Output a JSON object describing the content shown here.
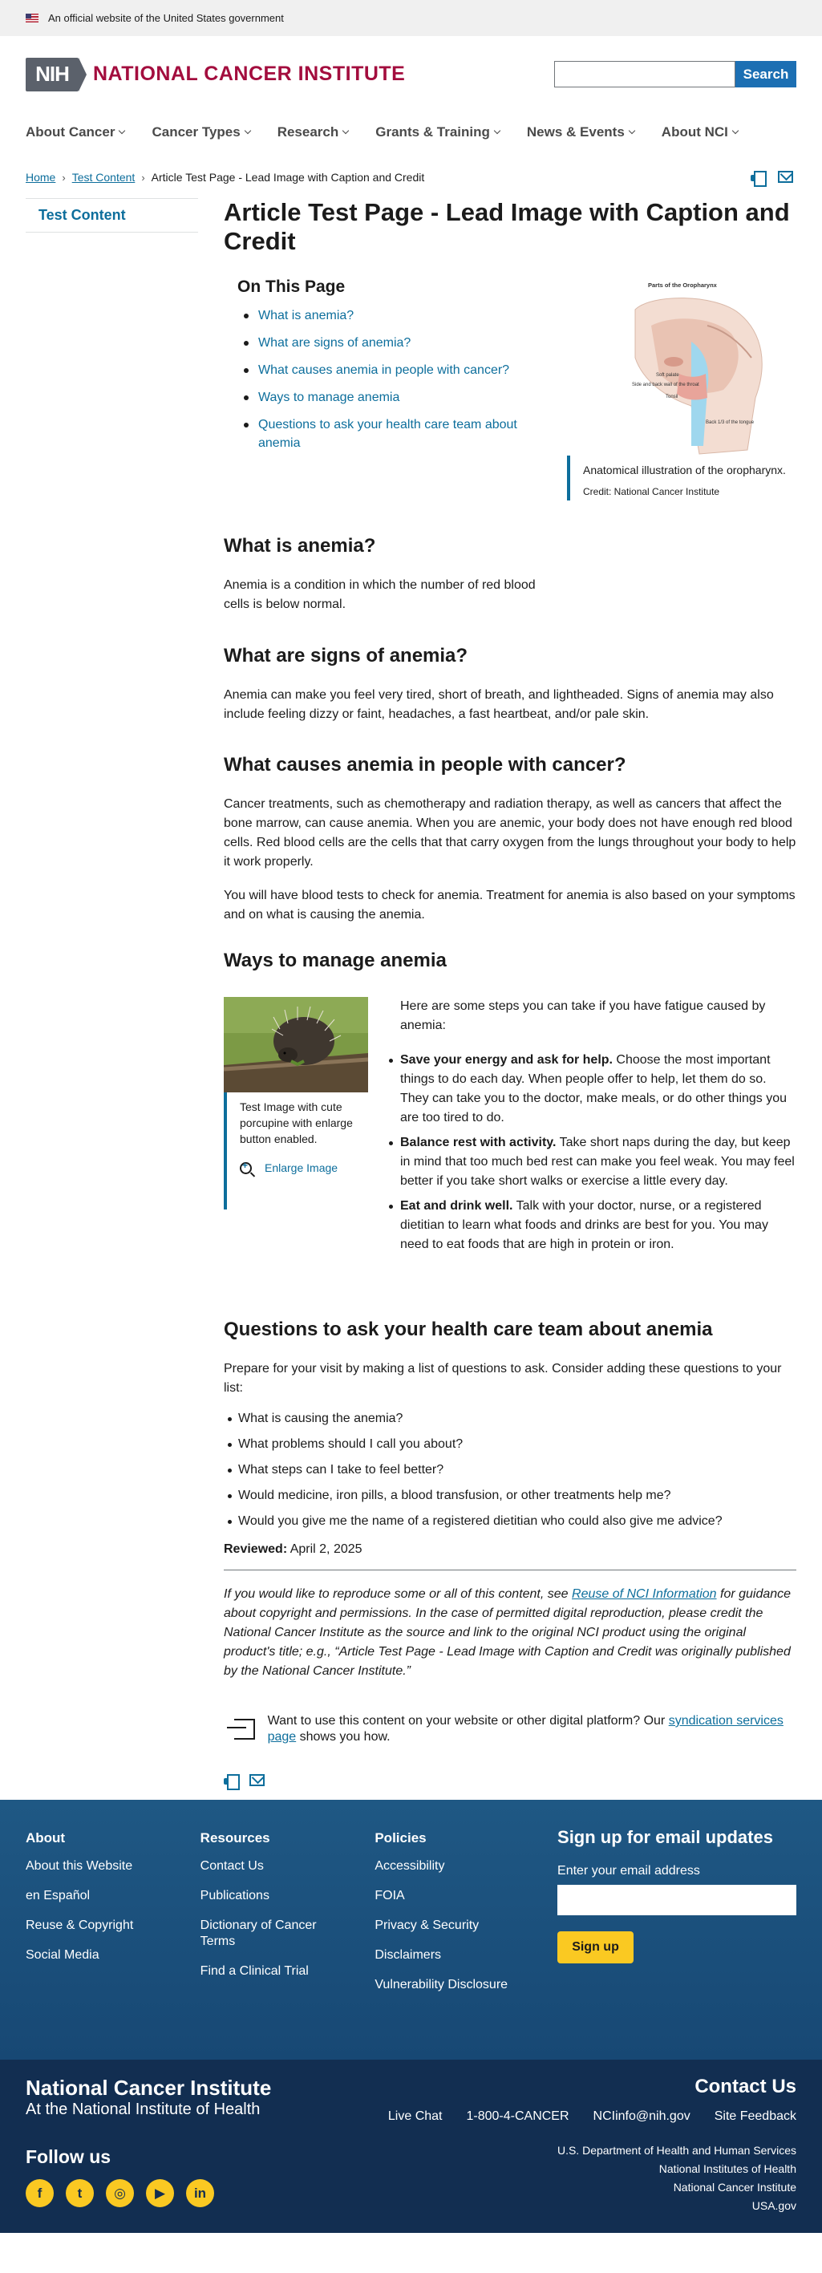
{
  "gov_banner": {
    "text": "An official website of the United States government"
  },
  "header": {
    "logo_mark": "NIH",
    "logo_text": "NATIONAL CANCER INSTITUTE",
    "search_placeholder": "",
    "search_button": "Search"
  },
  "nav": [
    {
      "label": "About Cancer"
    },
    {
      "label": "Cancer Types"
    },
    {
      "label": "Research"
    },
    {
      "label": "Grants & Training"
    },
    {
      "label": "News & Events"
    },
    {
      "label": "About NCI"
    }
  ],
  "breadcrumb": {
    "home": "Home",
    "parent": "Test Content",
    "current": "Article Test Page - Lead Image with Caption and Credit"
  },
  "sidebar": {
    "item": "Test Content"
  },
  "article": {
    "title": "Article Test Page - Lead Image with Caption and Credit",
    "on_this_page": {
      "heading": "On This Page",
      "links": [
        "What is anemia?",
        "What are signs of anemia?",
        "What causes anemia in people with cancer?",
        "Ways to manage anemia",
        "Questions to ask your health care team about anemia"
      ]
    },
    "lead_image": {
      "title": "Parts of the Oropharynx",
      "labels": [
        "Soft palate",
        "Side and back wall of the throat",
        "Tonsil",
        "Back 1/3 of the tongue"
      ],
      "caption": "Anatomical illustration of the oropharynx.",
      "credit": "Credit: National Cancer Institute"
    },
    "s1": {
      "heading": "What is anemia?",
      "p1": "Anemia is a condition in which the number of red blood cells is below normal."
    },
    "s2": {
      "heading": "What are signs of anemia?",
      "p1": "Anemia can make you feel very tired, short of breath, and lightheaded. Signs of anemia may also include feeling dizzy or faint, headaches, a fast heartbeat, and/or pale skin."
    },
    "s3": {
      "heading": "What causes anemia in people with cancer?",
      "p1": "Cancer treatments, such as chemotherapy and radiation therapy, as well as cancers that affect the bone marrow, can cause anemia. When you are anemic, your body does not have enough red blood cells. Red blood cells are the cells that that carry oxygen from the lungs throughout your body to help it work properly.",
      "p2": "You will have blood tests to check for anemia. Treatment for anemia is also based on your symptoms and on what is causing the anemia."
    },
    "s4": {
      "heading": "Ways to manage anemia",
      "image_caption": "Test Image with cute porcupine with enlarge button enabled.",
      "enlarge": "Enlarge Image",
      "intro": "Here are some steps you can take if you have fatigue caused by anemia:",
      "items": [
        {
          "bold": "Save your energy and ask for help.",
          "text": " Choose the most important things to do each day. When people offer to help, let them do so. They can take you to the doctor, make meals, or do other things you are too tired to do."
        },
        {
          "bold": "Balance rest with activity.",
          "text": " Take short naps during the day, but keep in mind that too much bed rest can make you feel weak. You may feel better if you take short walks or exercise a little every day."
        },
        {
          "bold": "Eat and drink well.",
          "text": " Talk with your doctor, nurse, or a registered dietitian to learn what foods and drinks are best for you. You may need to eat foods that are high in protein or iron."
        }
      ]
    },
    "s5": {
      "heading": "Questions to ask your health care team about anemia",
      "intro": "Prepare for your visit by making a list of questions to ask. Consider adding these questions to your list:",
      "questions": [
        "What is causing the anemia?",
        "What problems should I call you about?",
        "What steps can I take to feel better?",
        "Would medicine, iron pills, a blood transfusion, or other treatments help me?",
        "Would you give me the name of a registered dietitian who could also give me advice?"
      ]
    },
    "reviewed_label": "Reviewed:",
    "reviewed_date": "April 2, 2025",
    "reuse": {
      "pre": "If you would like to reproduce some or all of this content, see ",
      "link": "Reuse of NCI Information",
      "post": " for guidance about copyright and permissions. In the case of permitted digital reproduction, please credit the National Cancer Institute as the source and link to the original NCI product using the original product's title; e.g., “Article Test Page - Lead Image with Caption and Credit was originally published by the National Cancer Institute.”"
    },
    "syndication": {
      "pre": "Want to use this content on your website or other digital platform? Our ",
      "link": "syndication services page",
      "post": " shows you how."
    }
  },
  "footer": {
    "cols": [
      {
        "heading": "About",
        "links": [
          "About this Website",
          "en Español",
          "Reuse & Copyright",
          "Social Media"
        ]
      },
      {
        "heading": "Resources",
        "links": [
          "Contact Us",
          "Publications",
          "Dictionary of Cancer Terms",
          "Find a Clinical Trial"
        ]
      },
      {
        "heading": "Policies",
        "links": [
          "Accessibility",
          "FOIA",
          "Privacy & Security",
          "Disclaimers",
          "Vulnerability Disclosure"
        ]
      }
    ],
    "signup": {
      "heading": "Sign up for email updates",
      "label": "Enter your email address",
      "button": "Sign up"
    },
    "org_name": "National Cancer Institute",
    "org_sub": "At the National Institute of Health",
    "follow": "Follow us",
    "social": [
      "f",
      "t",
      "◎",
      "▶",
      "in"
    ],
    "contact_heading": "Contact Us",
    "contacts": [
      "Live Chat",
      "1-800-4-CANCER",
      "NCIinfo@nih.gov",
      "Site Feedback"
    ],
    "agencies": [
      "U.S. Department of Health and Human Services",
      "National Institutes of Health",
      "National Cancer Institute",
      "USA.gov"
    ]
  }
}
